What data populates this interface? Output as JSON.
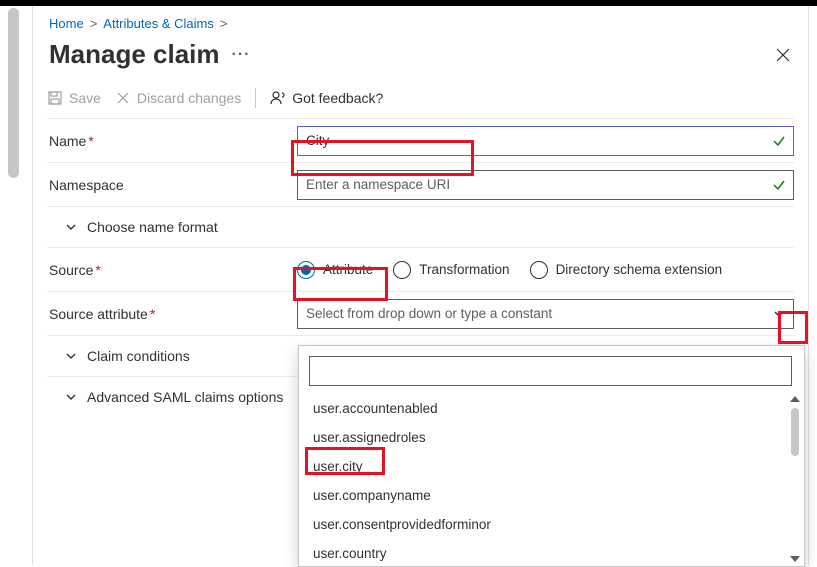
{
  "breadcrumb": {
    "home": "Home",
    "section": "Attributes & Claims"
  },
  "header": {
    "title": "Manage claim"
  },
  "cmdbar": {
    "save": "Save",
    "discard": "Discard changes",
    "feedback": "Got feedback?"
  },
  "form": {
    "name_label": "Name",
    "name_value": "City",
    "namespace_label": "Namespace",
    "namespace_placeholder": "Enter a namespace URI",
    "choose_format": "Choose name format",
    "source_label": "Source",
    "source_options": {
      "attribute": "Attribute",
      "transformation": "Transformation",
      "schema_ext": "Directory schema extension"
    },
    "source_attr_label": "Source attribute",
    "source_attr_placeholder": "Select from drop down or type a constant",
    "claim_conditions": "Claim conditions",
    "advanced_saml": "Advanced SAML claims options"
  },
  "dropdown": {
    "items": [
      "user.accountenabled",
      "user.assignedroles",
      "user.city",
      "user.companyname",
      "user.consentprovidedforminor",
      "user.country"
    ]
  }
}
